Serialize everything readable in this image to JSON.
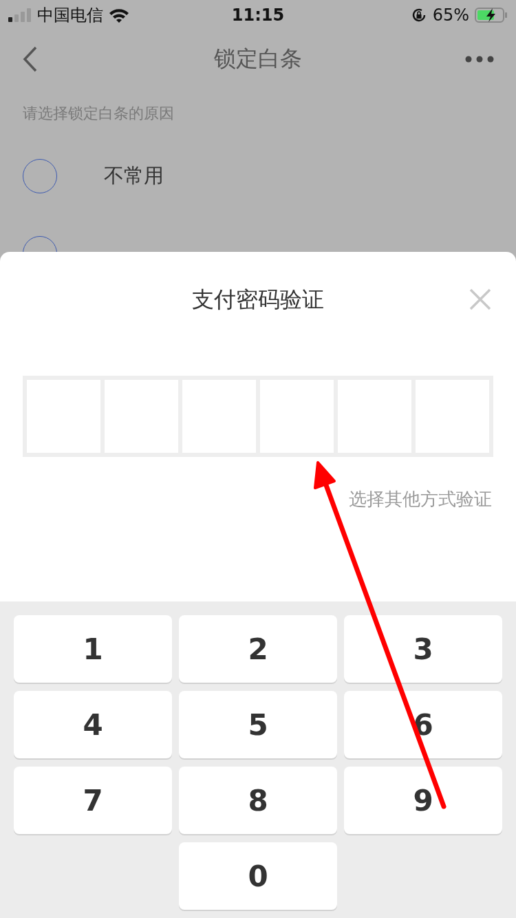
{
  "status_bar": {
    "carrier": "中国电信",
    "time": "11:15",
    "battery": "65%"
  },
  "nav": {
    "title": "锁定白条"
  },
  "prompt": "请选择锁定白条的原因",
  "options": [
    {
      "label": "不常用",
      "selected": false
    },
    {
      "selected": false
    }
  ],
  "dialog": {
    "title": "支付密码验证",
    "pin_cells": [
      {
        "filled": false
      },
      {
        "filled": false
      },
      {
        "filled": false
      },
      {
        "filled": false
      },
      {
        "filled": false
      },
      {
        "filled": false
      }
    ],
    "alt_link": "选择其他方式验证"
  },
  "keypad": {
    "keys": [
      "1",
      "2",
      "3",
      "4",
      "5",
      "6",
      "7",
      "8",
      "9",
      "0"
    ]
  }
}
